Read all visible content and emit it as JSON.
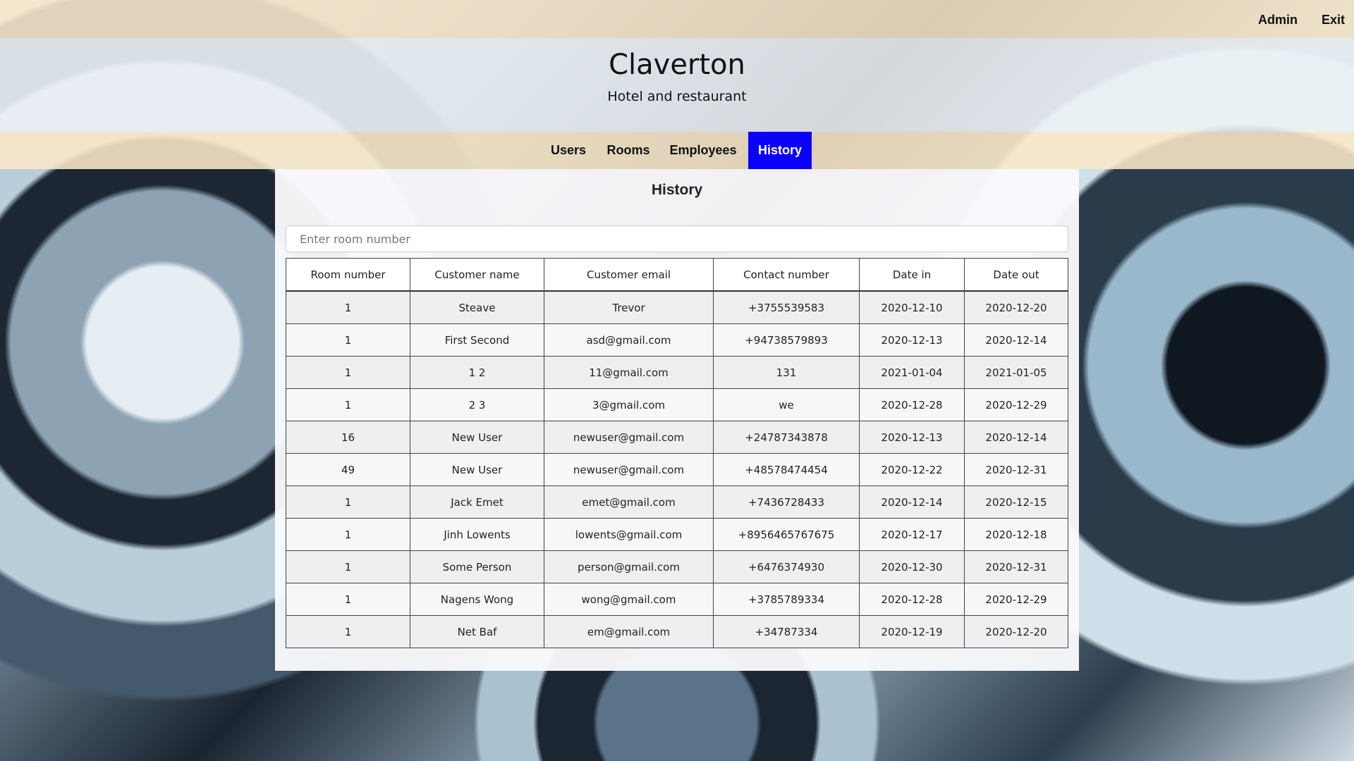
{
  "topbar": {
    "admin_label": "Admin",
    "exit_label": "Exit"
  },
  "brand": {
    "title": "Claverton",
    "subtitle": "Hotel and restaurant"
  },
  "nav": {
    "tabs": [
      {
        "label": "Users"
      },
      {
        "label": "Rooms"
      },
      {
        "label": "Employees"
      },
      {
        "label": "History"
      }
    ],
    "active": "History",
    "active_color": "#0b00ff"
  },
  "page": {
    "heading": "History"
  },
  "search": {
    "placeholder": "Enter room number",
    "value": ""
  },
  "table": {
    "headers": [
      "Room number",
      "Customer name",
      "Customer email",
      "Contact number",
      "Date in",
      "Date out"
    ],
    "rows": [
      [
        "1",
        "Steave",
        "Trevor",
        "+3755539583",
        "2020-12-10",
        "2020-12-20"
      ],
      [
        "1",
        "First Second",
        "asd@gmail.com",
        "+94738579893",
        "2020-12-13",
        "2020-12-14"
      ],
      [
        "1",
        "1 2",
        "11@gmail.com",
        "131",
        "2021-01-04",
        "2021-01-05"
      ],
      [
        "1",
        "2 3",
        "3@gmail.com",
        "we",
        "2020-12-28",
        "2020-12-29"
      ],
      [
        "16",
        "New User",
        "newuser@gmail.com",
        "+24787343878",
        "2020-12-13",
        "2020-12-14"
      ],
      [
        "49",
        "New User",
        "newuser@gmail.com",
        "+48578474454",
        "2020-12-22",
        "2020-12-31"
      ],
      [
        "1",
        "Jack Emet",
        "emet@gmail.com",
        "+7436728433",
        "2020-12-14",
        "2020-12-15"
      ],
      [
        "1",
        "Jinh Lowents",
        "lowents@gmail.com",
        "+8956465767675",
        "2020-12-17",
        "2020-12-18"
      ],
      [
        "1",
        "Some Person",
        "person@gmail.com",
        "+6476374930",
        "2020-12-30",
        "2020-12-31"
      ],
      [
        "1",
        "Nagens Wong",
        "wong@gmail.com",
        "+3785789334",
        "2020-12-28",
        "2020-12-29"
      ],
      [
        "1",
        "Net Baf",
        "em@gmail.com",
        "+34787334",
        "2020-12-19",
        "2020-12-20"
      ]
    ]
  }
}
